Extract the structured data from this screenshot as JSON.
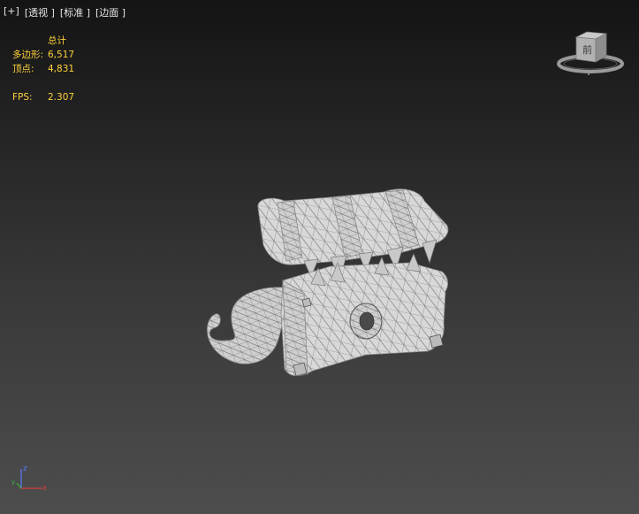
{
  "viewport_menu": {
    "plus": "[+]",
    "view": "[透视 ]",
    "shading": "[标准 ]",
    "style": "[边面 ]"
  },
  "stats": {
    "header": "总计",
    "polygons_label": "多边形:",
    "polygons_value": "6,517",
    "vertices_label": "顶点:",
    "vertices_value": "4,831",
    "fps_label": "FPS:",
    "fps_value": "2.307"
  },
  "viewcube": {
    "face_label": "前"
  },
  "axis_tripod": {
    "z": "z",
    "x": "x",
    "y": "y"
  },
  "colors": {
    "stats_text": "#ffd23c",
    "menu_text": "#e6e6e6",
    "mesh_fill": "#d8d8d8",
    "mesh_wire": "#6e6e6e",
    "axis_x": "#d23c3c",
    "axis_y": "#3cb43c",
    "axis_z": "#5a78ff"
  }
}
